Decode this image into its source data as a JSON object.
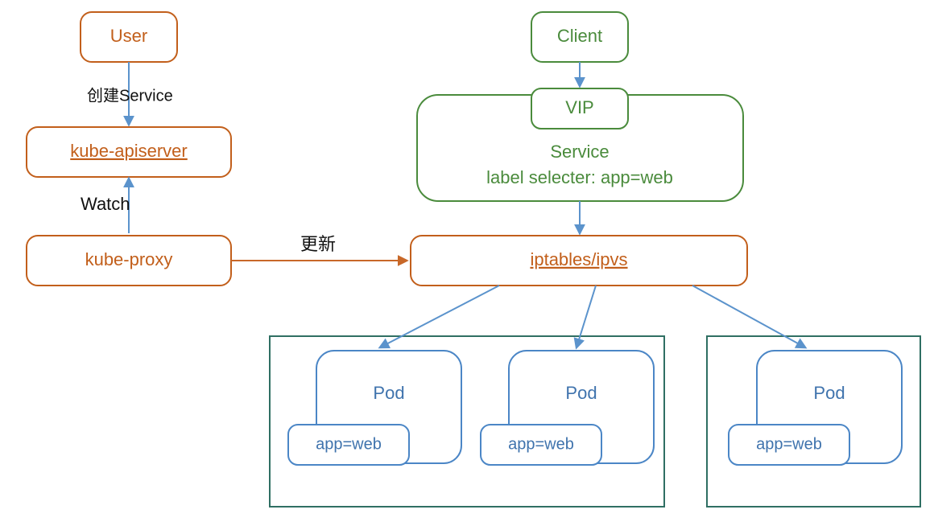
{
  "colors": {
    "brown": "#c25f1b",
    "green": "#4a8b3c",
    "blue": "#4b86c6",
    "teal": "#2f6f63",
    "arrow_blue": "#5b93cc",
    "arrow_brown": "#c86829",
    "underline_red": "#d23b3b"
  },
  "nodes": {
    "user": "User",
    "kube_apiserver": "kube-apiserver",
    "kube_proxy": "kube-proxy",
    "client": "Client",
    "vip": "VIP",
    "service_line1": "Service",
    "service_line2": "label selecter: app=web",
    "iptables": "iptables/ipvs",
    "pod": "Pod",
    "pod_label": "app=web"
  },
  "edges": {
    "create_service": "创建Service",
    "watch": "Watch",
    "update": "更新"
  }
}
